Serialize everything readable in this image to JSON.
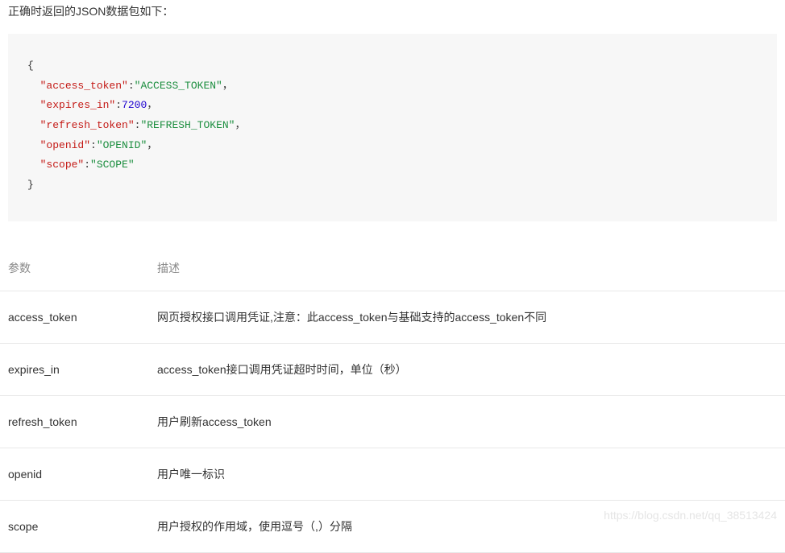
{
  "intro": "正确时返回的JSON数据包如下：",
  "code": {
    "open": "{",
    "lines": [
      {
        "key": "\"access_token\"",
        "colon": ":",
        "value": "\"ACCESS_TOKEN\"",
        "type": "string",
        "comma": "，"
      },
      {
        "key": "\"expires_in\"",
        "colon": ":",
        "value": "7200",
        "type": "number",
        "comma": "，"
      },
      {
        "key": "\"refresh_token\"",
        "colon": ":",
        "value": "\"REFRESH_TOKEN\"",
        "type": "string",
        "comma": "，"
      },
      {
        "key": "\"openid\"",
        "colon": ":",
        "value": "\"OPENID\"",
        "type": "string",
        "comma": "，"
      },
      {
        "key": "\"scope\"",
        "colon": ":",
        "value": "\"SCOPE\"",
        "type": "string",
        "comma": ""
      }
    ],
    "close": "}"
  },
  "table": {
    "headers": [
      "参数",
      "描述"
    ],
    "rows": [
      {
        "param": "access_token",
        "desc": "网页授权接口调用凭证,注意：此access_token与基础支持的access_token不同"
      },
      {
        "param": "expires_in",
        "desc": "access_token接口调用凭证超时时间，单位（秒）"
      },
      {
        "param": "refresh_token",
        "desc": "用户刷新access_token"
      },
      {
        "param": "openid",
        "desc": "用户唯一标识"
      },
      {
        "param": "scope",
        "desc": "用户授权的作用域，使用逗号（,）分隔"
      }
    ]
  },
  "watermark": "https://blog.csdn.net/qq_38513424"
}
